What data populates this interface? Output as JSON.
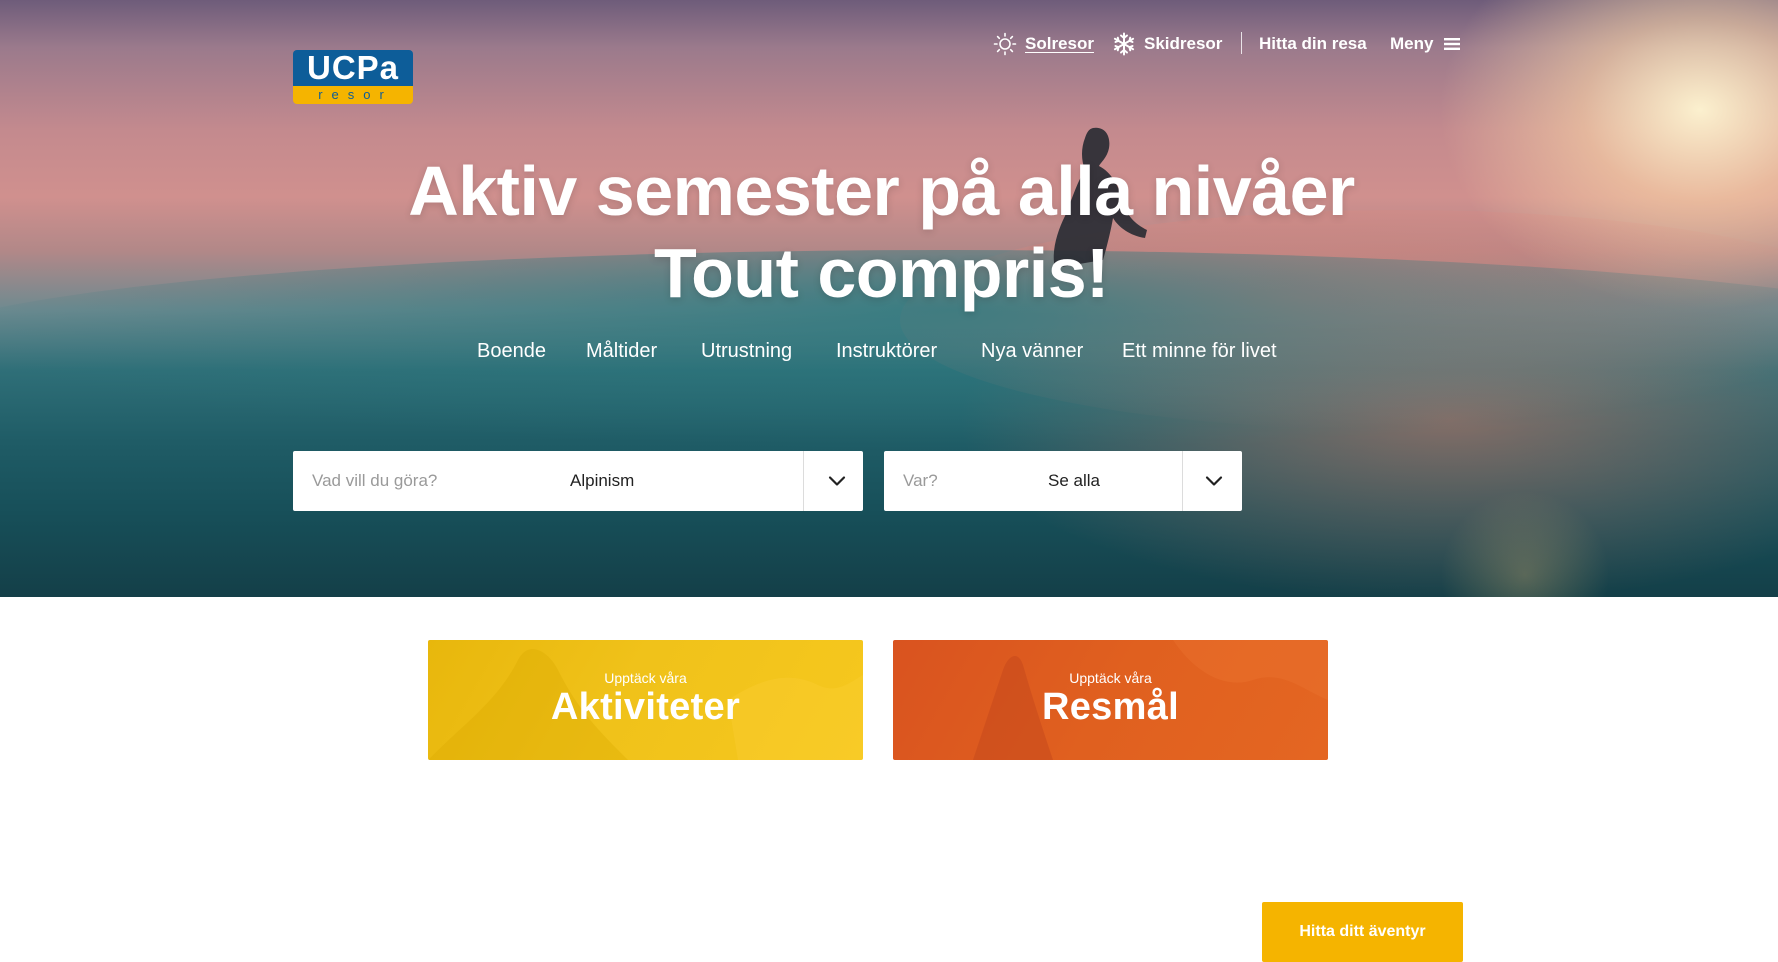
{
  "header": {
    "logo": {
      "top_text": "UCPa",
      "bottom_text": "resor"
    },
    "nav": [
      {
        "label": "Solresor",
        "icon": "sun-icon",
        "active": true
      },
      {
        "label": "Skidresor",
        "icon": "snowflake-icon"
      },
      {
        "label": "Hitta din resa"
      },
      {
        "label": "Meny",
        "icon": "hamburger-menu-icon"
      }
    ]
  },
  "hero": {
    "headline_line1": "Aktiv semester på alla nivåer",
    "headline_line2": "Tout compris!",
    "features": [
      "Boende",
      "Måltider",
      "Utrustning",
      "Instruktörer",
      "Nya vänner",
      "Ett minne för livet"
    ]
  },
  "search": {
    "activity": {
      "placeholder": "Vad vill du göra?",
      "value": "Alpinism"
    },
    "destination": {
      "placeholder": "Var?",
      "value": "Se alla"
    },
    "submit_label": "Hitta ditt äventyr"
  },
  "cards": [
    {
      "small": "Upptäck våra",
      "big": "Aktiviteter",
      "color": "#f0c21a"
    },
    {
      "small": "Upptäck våra",
      "big": "Resmål",
      "color": "#e0601f"
    }
  ],
  "colors": {
    "accent": "#f5b400",
    "brand_blue": "#0d5d99",
    "orange": "#e0601f"
  }
}
